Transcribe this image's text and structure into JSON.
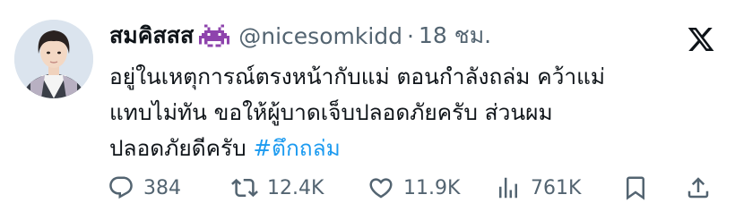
{
  "tweet": {
    "display_name": "สมคิสสส",
    "display_emoji": "alien-monster-emoji",
    "handle": "@nicesomkidd",
    "separator": "·",
    "time": "18 ชม.",
    "text_lines": [
      "อยู่ในเหตุการณ์ตรงหน้ากับแม่ ตอนกำลังถล่ม คว้าแม่",
      "แทบไม่ทัน ขอให้ผู้บาดเจ็บปลอดภัยครับ ส่วนผม",
      "ปลอดภัยดีครับ "
    ],
    "hashtag": "#ตึกถล่ม",
    "hashtag_color": "#1d9bf0"
  },
  "actions": {
    "reply": {
      "icon": "reply-icon",
      "count": "384"
    },
    "retweet": {
      "icon": "retweet-icon",
      "count": "12.4K"
    },
    "like": {
      "icon": "heart-icon",
      "count": "11.9K"
    },
    "views": {
      "icon": "views-icon",
      "count": "761K"
    },
    "bookmark": {
      "icon": "bookmark-icon"
    },
    "share": {
      "icon": "share-icon"
    }
  },
  "colors": {
    "text": "#0f1419",
    "secondary": "#536471",
    "accent": "#1d9bf0",
    "emoji": "#8e44ad"
  }
}
